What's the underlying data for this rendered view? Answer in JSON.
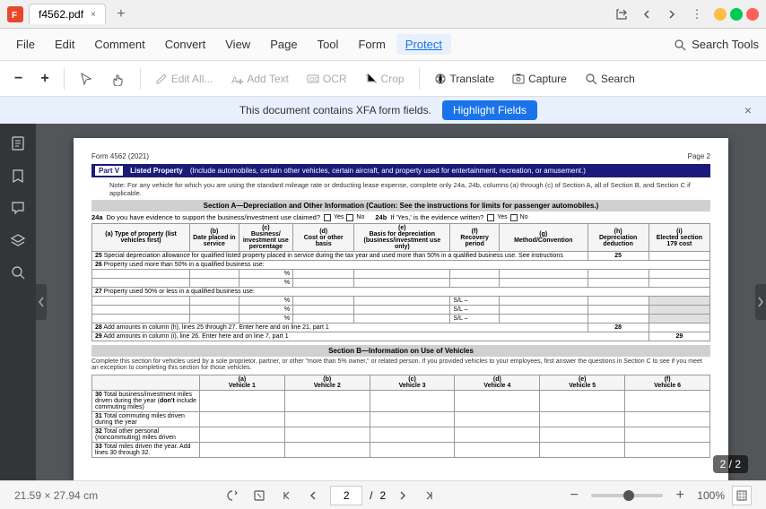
{
  "titlebar": {
    "app_icon": "F",
    "tab_name": "f4562.pdf",
    "new_tab": "+",
    "window_controls": {
      "minimize": "−",
      "maximize": "□",
      "close": "×"
    }
  },
  "menubar": {
    "items": [
      "File",
      "Edit",
      "Comment",
      "Convert",
      "View",
      "Page",
      "Tool",
      "Form",
      "Protect"
    ]
  },
  "toolbar": {
    "zoom_out": "−",
    "zoom_in": "+",
    "edit_all": "Edit All...",
    "add_text": "Add Text",
    "ocr": "OCR",
    "crop": "Crop",
    "translate": "Translate",
    "capture": "Capture",
    "search": "Search",
    "search_tools": "Search Tools"
  },
  "notification": {
    "message": "This document contains XFA form fields.",
    "highlight_btn": "Highlight Fields",
    "close": "×"
  },
  "document": {
    "form_label": "Form 4562 (2021)",
    "page_label": "Page 2",
    "part_label": "Part V",
    "part_title": "Listed Property",
    "part_desc": "(Include automobiles, certain other vehicles, certain aircraft, and property used for entertainment, recreation, or amusement.)",
    "note_text": "Note: For any vehicle for which you are using the standard mileage rate or deducting lease expense, complete only 24a, 24b, columns (a) through (c) of Section A, all of Section B, and Section C if applicable.",
    "section_a_header": "Section A—Depreciation and Other Information (Caution: See the instructions for limits for passenger automobiles.)",
    "row_24a_label": "Do you have evidence to support the business/investment use claimed?",
    "yes_label": "Yes",
    "no_label": "No",
    "row_24b_label": "24b",
    "if_yes_label": "If 'Yes,' is the evidence written?",
    "col_a": "(a)\nType of property (list\nvehicles first)",
    "col_b": "(b)\nDate placed in\nservice",
    "col_c": "(c)\nBusiness/\ninvestment use\npercentage",
    "col_d": "(d)\nCost or other basis",
    "col_e": "(e)\nBasis for depreciation\n(business/investment use\nonly)",
    "col_f": "(f)\nRecovery period",
    "col_g": "(g)\nMethod/Convention",
    "col_h": "(h)\nDepreciation deduction",
    "col_i": "(i)\nElected section 179 cost",
    "row_25": "25  Special depreciation allowance for qualified listed property placed in service during the tax  year and used more than 50% in a qualified business use. See instructions",
    "row_25_num": "25",
    "row_26": "26  Property used more than 50% in a qualified business use:",
    "percent": "%",
    "row_27": "27  Property used 50% or less in a qualified business use:",
    "sl": "S/L –",
    "row_28": "28  Add amounts in column (h), lines 25 through 27. Enter here and on line 21, part 1",
    "row_28_num": "28",
    "row_29": "29  Add amounts in column (i), line 26. Enter here and on line 7, part 1",
    "row_29_num": "29",
    "section_b_header": "Section B—Information on Use of Vehicles",
    "section_b_note": "Complete this section for vehicles used by a sole proprietor, partner, or other \"more than 5% owner,\" or related person. If you provided vehicles to your employees, first answer the questions in Section C to see if you meet an exception to completing this section for those vehicles.",
    "vehicle_cols": [
      "(a)\nVehicle 1",
      "(b)\nVehicle 2",
      "(c)\nVehicle 3",
      "(d)\nVehicle 4",
      "(e)\nVehicle 5",
      "(f)\nVehicle 6"
    ],
    "row_30": "30",
    "row_30_label": "Total business/investment miles driven during the year (don't include commuting miles)",
    "row_31": "31",
    "row_31_label": "Total commuting miles driven during the year",
    "row_32": "32",
    "row_32_label": "Total other personal (noncommuting) miles driven",
    "row_33_label": "Total  miles driven the year. Add lines 30 through 32.",
    "row_33": "33"
  },
  "statusbar": {
    "dimensions": "21.59 × 27.94 cm",
    "nav_first": "⟨⟨",
    "nav_prev": "⟨",
    "page_current": "2",
    "page_separator": "/",
    "page_total": "2",
    "nav_next": "⟩",
    "nav_last": "⟩⟩",
    "zoom_out": "−",
    "zoom_in": "+",
    "zoom_percent": "100%",
    "page_badge": "2 / 2"
  }
}
